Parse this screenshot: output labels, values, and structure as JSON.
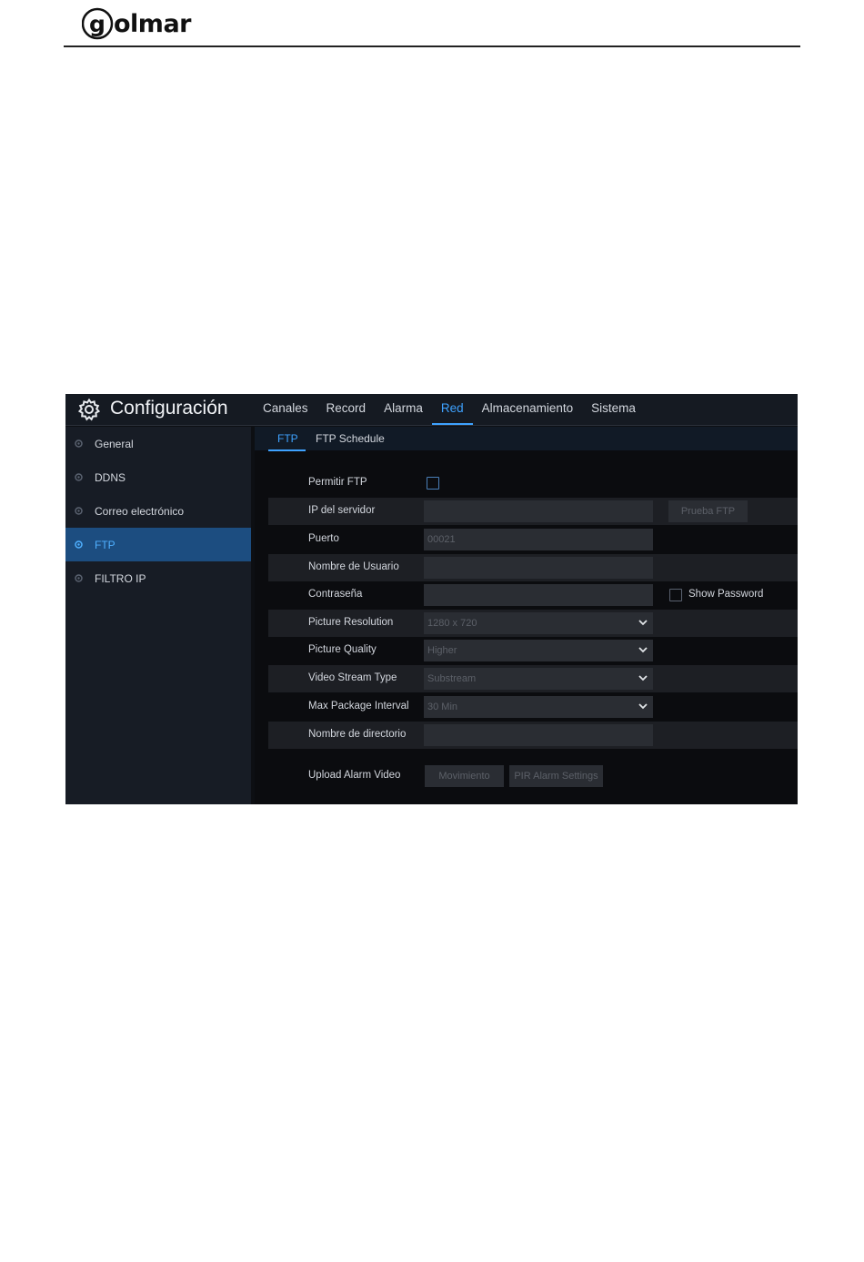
{
  "document": {
    "logo_text": "olmar",
    "logo_letter": "g"
  },
  "header": {
    "title": "Configuración"
  },
  "nav": {
    "tabs": [
      {
        "label": "Canales"
      },
      {
        "label": "Record"
      },
      {
        "label": "Alarma"
      },
      {
        "label": "Red",
        "active": true
      },
      {
        "label": "Almacenamiento"
      },
      {
        "label": "Sistema"
      }
    ]
  },
  "sidebar": {
    "items": [
      {
        "label": "General"
      },
      {
        "label": "DDNS"
      },
      {
        "label": "Correo electrónico"
      },
      {
        "label": "FTP",
        "active": true
      },
      {
        "label": "FILTRO IP"
      }
    ]
  },
  "subtabs": [
    {
      "label": "FTP",
      "active": true
    },
    {
      "label": "FTP Schedule"
    }
  ],
  "form": {
    "enable_ftp": {
      "label": "Permitir FTP",
      "checked": false
    },
    "server_ip": {
      "label": "IP del servidor",
      "value": "",
      "test_button": "Prueba FTP"
    },
    "port": {
      "label": "Puerto",
      "value": "00021"
    },
    "username": {
      "label": "Nombre de Usuario",
      "value": ""
    },
    "password": {
      "label": "Contraseña",
      "value": "",
      "show_password_label": "Show Password",
      "show_password_checked": false
    },
    "picture_resolution": {
      "label": "Picture Resolution",
      "value": "1280 x 720"
    },
    "picture_quality": {
      "label": "Picture Quality",
      "value": "Higher"
    },
    "video_stream_type": {
      "label": "Video Stream Type",
      "value": "Substream"
    },
    "max_package_interval": {
      "label": "Max Package Interval",
      "value": "30 Min"
    },
    "directory_name": {
      "label": "Nombre de directorio",
      "value": ""
    },
    "upload_alarm_video": {
      "label": "Upload Alarm Video",
      "motion_button": "Movimiento",
      "pir_button": "PIR Alarm Settings"
    }
  },
  "colors": {
    "accent": "#3ea2ff",
    "sidebar_active": "#1c4d80",
    "background": "#0b0c0f"
  }
}
